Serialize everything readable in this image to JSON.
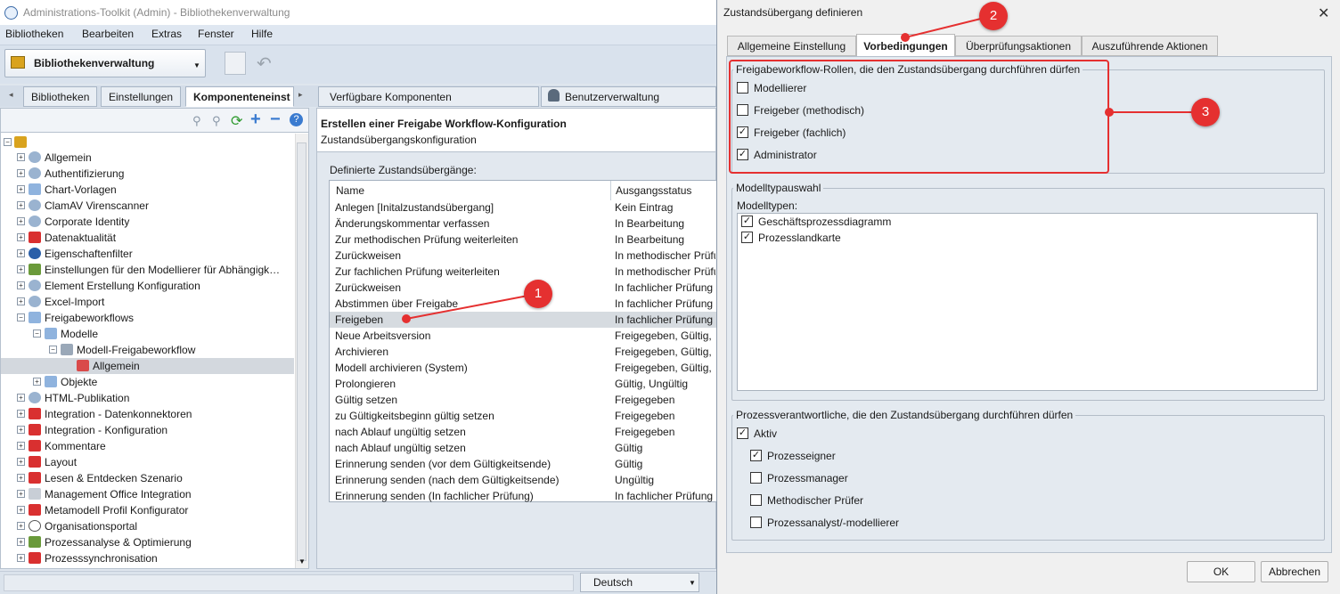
{
  "window": {
    "title": "Administrations-Toolkit (Admin) - Bibliothekenverwaltung"
  },
  "menu": [
    "Bibliotheken",
    "Bearbeiten",
    "Extras",
    "Fenster",
    "Hilfe"
  ],
  "toolbar": {
    "library_combo": "Bibliothekenverwaltung"
  },
  "left_tabs": [
    "Bibliotheken",
    "Einstellungen",
    "Komponenteneinst"
  ],
  "tree": [
    {
      "label": "Allgemein",
      "level": 1,
      "icon": "globe-icon",
      "exp": "+"
    },
    {
      "label": "Authentifizierung",
      "level": 1,
      "icon": "globe-icon",
      "exp": "+"
    },
    {
      "label": "Chart-Vorlagen",
      "level": 1,
      "icon": "folder-icon",
      "exp": "+"
    },
    {
      "label": "ClamAV Virenscanner",
      "level": 1,
      "icon": "globe-icon",
      "exp": "+"
    },
    {
      "label": "Corporate Identity",
      "level": 1,
      "icon": "globe-icon",
      "exp": "+"
    },
    {
      "label": "Datenaktualität",
      "level": 1,
      "icon": "red-flag-icon",
      "exp": "+"
    },
    {
      "label": "Eigenschaftenfilter",
      "level": 1,
      "icon": "circle-icon",
      "exp": "+"
    },
    {
      "label": "Einstellungen für den Modellierer für Abhängigk…",
      "level": 1,
      "icon": "chart-icon",
      "exp": "+"
    },
    {
      "label": "Element Erstellung Konfiguration",
      "level": 1,
      "icon": "globe-icon",
      "exp": "+"
    },
    {
      "label": "Excel-Import",
      "level": 1,
      "icon": "globe-icon",
      "exp": "+"
    },
    {
      "label": "Freigabeworkflows",
      "level": 1,
      "icon": "folder-icon",
      "exp": "-"
    },
    {
      "label": "Modelle",
      "level": 2,
      "icon": "folder-icon",
      "exp": "-"
    },
    {
      "label": "Modell-Freigabeworkflow",
      "level": 3,
      "icon": "workflow-icon",
      "exp": "-"
    },
    {
      "label": "Allgemein",
      "level": 4,
      "icon": "red-doc-icon",
      "exp": ""
    },
    {
      "label": "Objekte",
      "level": 2,
      "icon": "folder-icon",
      "exp": "+"
    },
    {
      "label": "HTML-Publikation",
      "level": 1,
      "icon": "globe-icon",
      "exp": "+"
    },
    {
      "label": "Integration - Datenkonnektoren",
      "level": 1,
      "icon": "red-flag-icon",
      "exp": "+"
    },
    {
      "label": "Integration - Konfiguration",
      "level": 1,
      "icon": "red-flag-icon",
      "exp": "+"
    },
    {
      "label": "Kommentare",
      "level": 1,
      "icon": "red-flag-icon",
      "exp": "+"
    },
    {
      "label": "Layout",
      "level": 1,
      "icon": "red-flag-icon",
      "exp": "+"
    },
    {
      "label": "Lesen & Entdecken Szenario",
      "level": 1,
      "icon": "red-flag-icon",
      "exp": "+"
    },
    {
      "label": "Management Office Integration",
      "level": 1,
      "icon": "doc-icon",
      "exp": "+"
    },
    {
      "label": "Metamodell Profil Konfigurator",
      "level": 1,
      "icon": "red-flag-icon",
      "exp": "+"
    },
    {
      "label": "Organisationsportal",
      "level": 1,
      "icon": "eye-icon",
      "exp": "+"
    },
    {
      "label": "Prozessanalyse & Optimierung",
      "level": 1,
      "icon": "chart-icon",
      "exp": "+"
    },
    {
      "label": "Prozesssynchronisation",
      "level": 1,
      "icon": "red-flag-icon",
      "exp": "+"
    }
  ],
  "right_tabs": [
    "Verfügbare Komponenten",
    "Benutzerverwaltung"
  ],
  "content": {
    "title": "Erstellen einer Freigabe Workflow-Konfiguration",
    "subtitle": "Zustandsübergangskonfiguration",
    "table_label": "Definierte Zustandsübergänge:",
    "col_name": "Name",
    "col_status": "Ausgangsstatus",
    "rows": [
      [
        "Anlegen [Initalzustandsübergang]",
        "Kein Eintrag"
      ],
      [
        "Änderungskommentar verfassen",
        "In Bearbeitung"
      ],
      [
        "Zur methodischen Prüfung weiterleiten",
        "In Bearbeitung"
      ],
      [
        "Zurückweisen",
        "In methodischer Prüfung"
      ],
      [
        "Zur fachlichen Prüfung weiterleiten",
        "In methodischer Prüfung"
      ],
      [
        "Zurückweisen",
        "In fachlicher Prüfung"
      ],
      [
        "Abstimmen über Freigabe",
        "In fachlicher Prüfung"
      ],
      [
        "Freigeben",
        "In fachlicher Prüfung"
      ],
      [
        "Neue Arbeitsversion",
        "Freigegeben, Gültig,"
      ],
      [
        "Archivieren",
        "Freigegeben, Gültig,"
      ],
      [
        "Modell archivieren (System)",
        "Freigegeben, Gültig,"
      ],
      [
        "Prolongieren",
        "Gültig, Ungültig"
      ],
      [
        "Gültig setzen",
        "Freigegeben"
      ],
      [
        "zu Gültigkeitsbeginn gültig setzen",
        "Freigegeben"
      ],
      [
        "nach Ablauf ungültig setzen",
        "Freigegeben"
      ],
      [
        "nach Ablauf ungültig setzen",
        "Gültig"
      ],
      [
        "Erinnerung senden (vor dem Gültigkeitsende)",
        "Gültig"
      ],
      [
        "Erinnerung senden (nach dem Gültigkeitsende)",
        "Ungültig"
      ],
      [
        "Erinnerung senden (In fachlicher Prüfung)",
        "In fachlicher Prüfung"
      ]
    ]
  },
  "status": {
    "language": "Deutsch"
  },
  "dialog": {
    "title": "Zustandsübergang definieren",
    "close": "✕",
    "tabs": [
      "Allgemeine Einstellung",
      "Vorbedingungen",
      "Überprüfungsaktionen",
      "Auszuführende Aktionen"
    ],
    "roles_group": "Freigabeworkflow-Rollen, die den Zustandsübergang durchführen dürfen",
    "roles": [
      {
        "label": "Modellierer",
        "checked": false
      },
      {
        "label": "Freigeber (methodisch)",
        "checked": false
      },
      {
        "label": "Freigeber (fachlich)",
        "checked": true
      },
      {
        "label": "Administrator",
        "checked": true
      }
    ],
    "types_group": "Modelltypauswahl",
    "types_label": "Modelltypen:",
    "types": [
      {
        "label": "Geschäftsprozessdiagramm",
        "checked": true
      },
      {
        "label": "Prozesslandkarte",
        "checked": true
      }
    ],
    "owners_group": "Prozessverantwortliche, die den Zustandsübergang durchführen dürfen",
    "active": {
      "label": "Aktiv",
      "checked": true
    },
    "owners": [
      {
        "label": "Prozesseigner",
        "checked": true
      },
      {
        "label": "Prozessmanager",
        "checked": false
      },
      {
        "label": "Methodischer Prüfer",
        "checked": false
      },
      {
        "label": "Prozessanalyst/-modellierer",
        "checked": false
      }
    ],
    "ok": "OK",
    "cancel": "Abbrechen"
  },
  "annotations": [
    "1",
    "2",
    "3"
  ],
  "colors": {
    "annotation": "#e53030",
    "accent": "#3a6aa8"
  }
}
